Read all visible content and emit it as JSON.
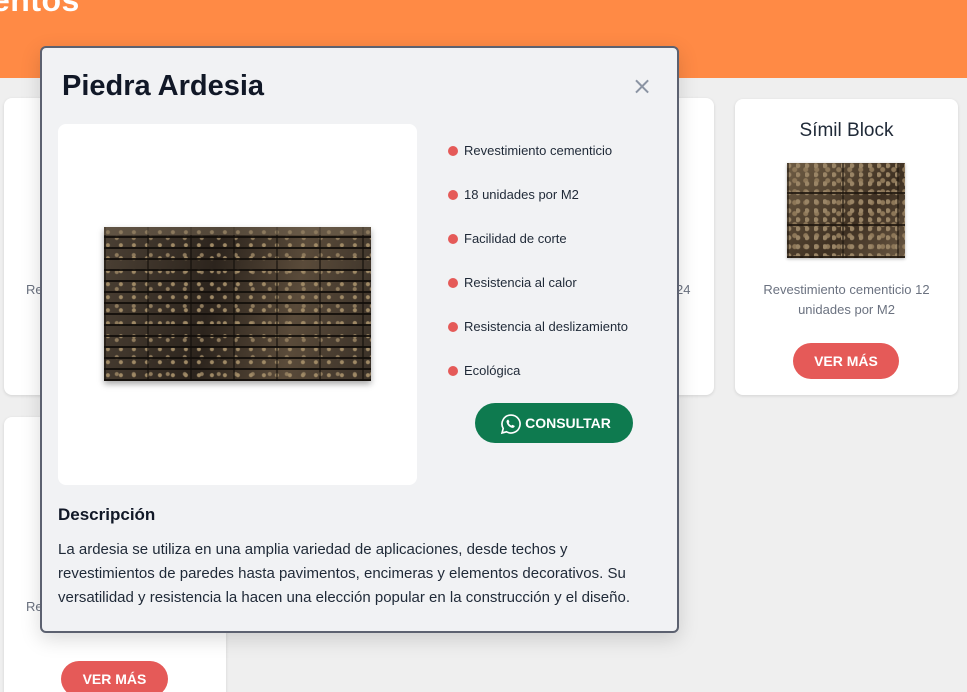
{
  "page": {
    "banner_title": "entos"
  },
  "background_cards": {
    "peek_texts": [
      "Re",
      "24",
      "Re"
    ],
    "simil_block": {
      "title": "Símil Block",
      "description": "Revestimiento cementicio 12 unidades por M2",
      "button_label": "VER MÁS"
    },
    "bottom_card": {
      "button_label": "VER MÁS"
    }
  },
  "modal": {
    "title": "Piedra Ardesia",
    "close_icon": "close-icon",
    "features": [
      "Revestimiento cementicio",
      "18 unidades por M2",
      "Facilidad de corte",
      "Resistencia al calor",
      "Resistencia al deslizamiento",
      "Ecológica"
    ],
    "consult_button": "CONSULTAR",
    "description_heading": "Descripción",
    "description_text": "La ardesia se utiliza en una amplia variedad de aplicaciones, desde techos y revestimientos de paredes hasta pavimentos, encimeras y elementos decorativos. Su versatilidad y resistencia la hacen una elección popular en la construcción y el diseño."
  },
  "colors": {
    "banner": "#ff8a45",
    "accent_red": "#e55a58",
    "whatsapp_green": "#0e7a4f"
  }
}
